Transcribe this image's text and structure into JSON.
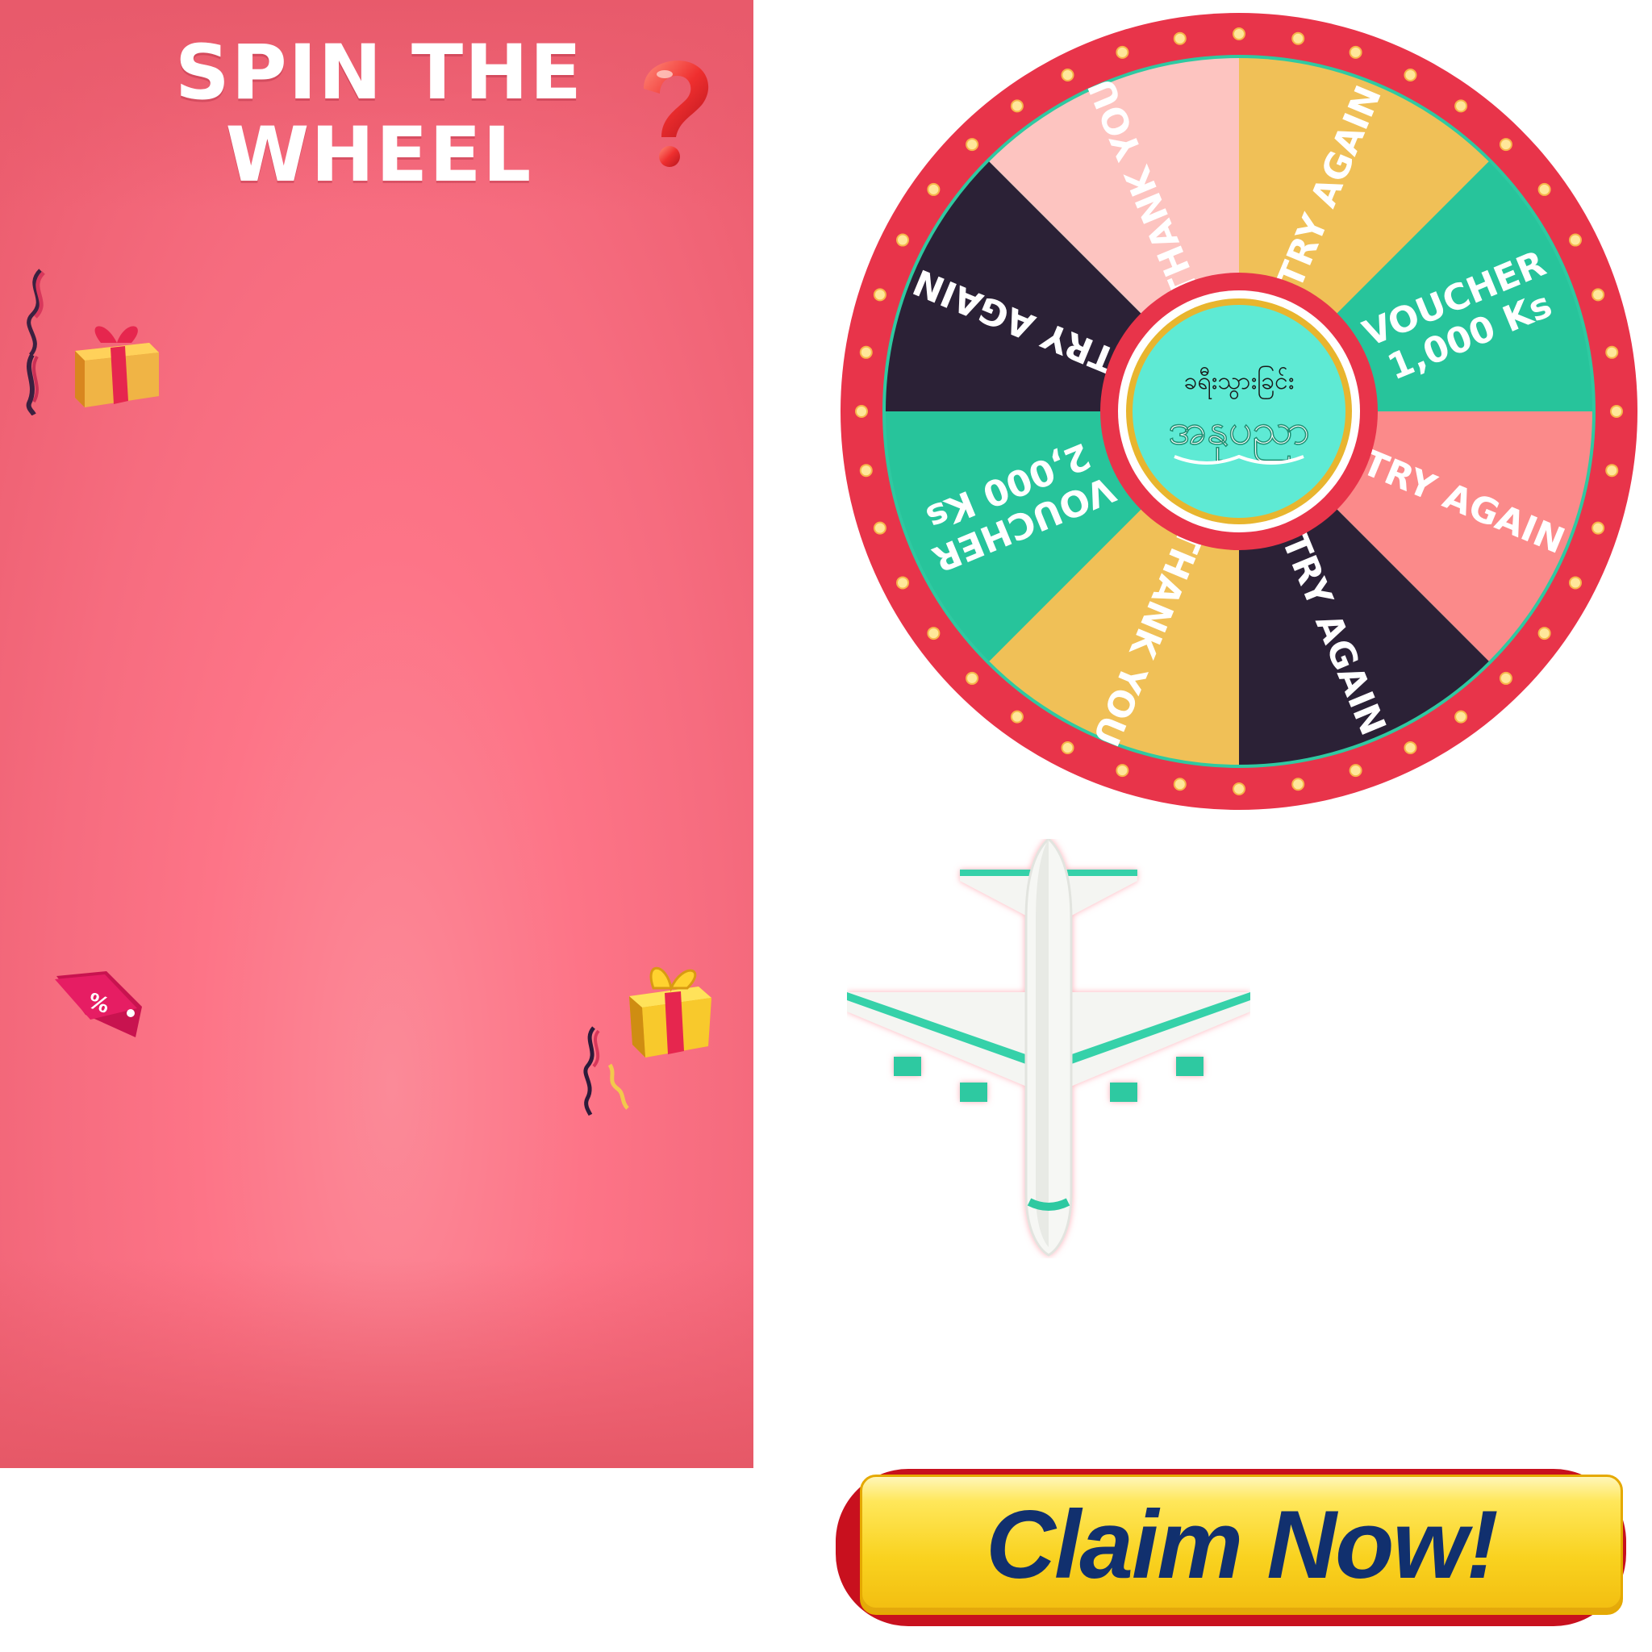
{
  "promo": {
    "title_line1": "SPIN THE",
    "title_line2": "WHEEL",
    "icons": [
      "question-mark-icon",
      "gift-box-icon",
      "discount-tag-icon",
      "confetti-icon",
      "airplane-icon"
    ]
  },
  "discount_tag": {
    "label": "%"
  },
  "wheel": {
    "segments": [
      {
        "label": "TRY AGAIN",
        "color": "#f0c057"
      },
      {
        "label": "VOUCHER 1,000 Ks",
        "color": "#27c49b"
      },
      {
        "label": "TRY AGAIN",
        "color": "#fb8a8a"
      },
      {
        "label": "TRY AGAIN",
        "color": "#2b2136"
      },
      {
        "label": "THANK YOU",
        "color": "#f0c057"
      },
      {
        "label": "VOUCHER 2,000 Ks",
        "color": "#27c49b"
      },
      {
        "label": "TRY AGAIN",
        "color": "#2b2136"
      },
      {
        "label": "THANK YOU",
        "color": "#fdc4c0"
      }
    ],
    "hub": {
      "line1": "ခရီးသွားခြင်း",
      "line2": "အနုပညာ"
    },
    "rim_color": "#e8344a",
    "bulb_color": "#ffe79a"
  },
  "cta": {
    "label": "Claim Now!"
  }
}
